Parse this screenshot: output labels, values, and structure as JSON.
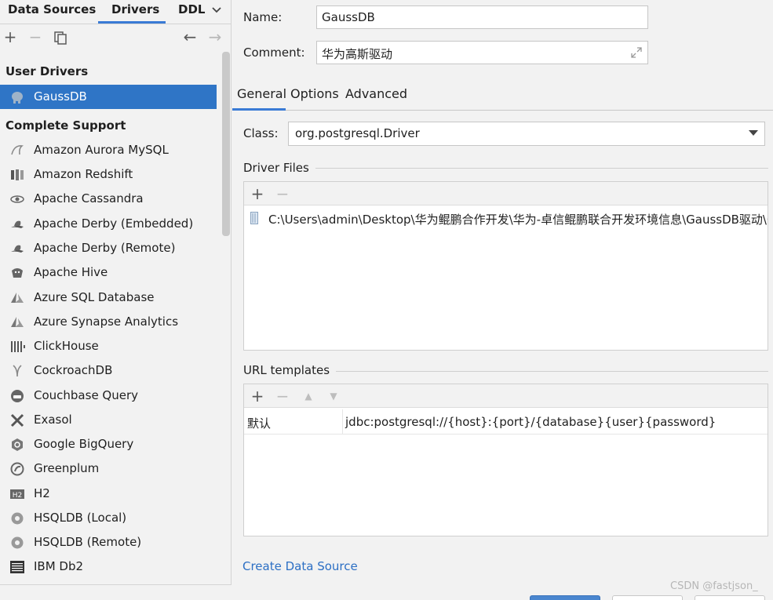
{
  "tabs": {
    "data_sources": "Data Sources",
    "drivers": "Drivers",
    "ddl": "DDL"
  },
  "left_toolbar": {
    "add": "+",
    "remove": "−",
    "back": "←",
    "forward": "→"
  },
  "sections": {
    "user_drivers": "User Drivers",
    "complete_support": "Complete Support"
  },
  "user_drivers": [
    {
      "label": "GaussDB",
      "icon": "elephant-icon",
      "selected": true
    }
  ],
  "complete_support": [
    {
      "label": "Amazon Aurora MySQL",
      "icon": "dolphin-icon"
    },
    {
      "label": "Amazon Redshift",
      "icon": "redshift-icon"
    },
    {
      "label": "Apache Cassandra",
      "icon": "eye-icon"
    },
    {
      "label": "Apache Derby (Embedded)",
      "icon": "derby-hat-icon"
    },
    {
      "label": "Apache Derby (Remote)",
      "icon": "derby-hat-icon"
    },
    {
      "label": "Apache Hive",
      "icon": "hive-icon"
    },
    {
      "label": "Azure SQL Database",
      "icon": "azure-icon"
    },
    {
      "label": "Azure Synapse Analytics",
      "icon": "azure-icon"
    },
    {
      "label": "ClickHouse",
      "icon": "clickhouse-icon"
    },
    {
      "label": "CockroachDB",
      "icon": "cockroach-icon"
    },
    {
      "label": "Couchbase Query",
      "icon": "couchbase-icon"
    },
    {
      "label": "Exasol",
      "icon": "exasol-icon"
    },
    {
      "label": "Google BigQuery",
      "icon": "bigquery-icon"
    },
    {
      "label": "Greenplum",
      "icon": "greenplum-icon"
    },
    {
      "label": "H2",
      "icon": "h2-icon"
    },
    {
      "label": "HSQLDB (Local)",
      "icon": "hsqldb-icon"
    },
    {
      "label": "HSQLDB (Remote)",
      "icon": "hsqldb-icon"
    },
    {
      "label": "IBM Db2",
      "icon": "ibm-db2-icon"
    }
  ],
  "form": {
    "name_label": "Name:",
    "name_value": "GaussDB",
    "comment_label": "Comment:",
    "comment_value": "华为高斯驱动"
  },
  "detail_tabs": {
    "general": "General",
    "options": "Options",
    "advanced": "Advanced"
  },
  "class": {
    "label": "Class:",
    "value": "org.postgresql.Driver"
  },
  "driver_files": {
    "title": "Driver Files",
    "add": "+",
    "remove": "−",
    "files": [
      "C:\\Users\\admin\\Desktop\\华为鲲鹏合作开发\\华为-卓信鲲鹏联合开发环境信息\\GaussDB驱动\\G"
    ]
  },
  "url_templates": {
    "title": "URL templates",
    "add": "+",
    "remove": "−",
    "up": "▲",
    "down": "▼",
    "rows": [
      {
        "name": "默认",
        "template": "jdbc:postgresql://{host}:{port}/{database}{user}{password}"
      }
    ]
  },
  "create_link": "Create Data Source",
  "watermark": "CSDN @fastjson_",
  "colors": {
    "accent": "#2f75c6",
    "link": "#2c6fc4",
    "background": "#f2f2f2"
  }
}
